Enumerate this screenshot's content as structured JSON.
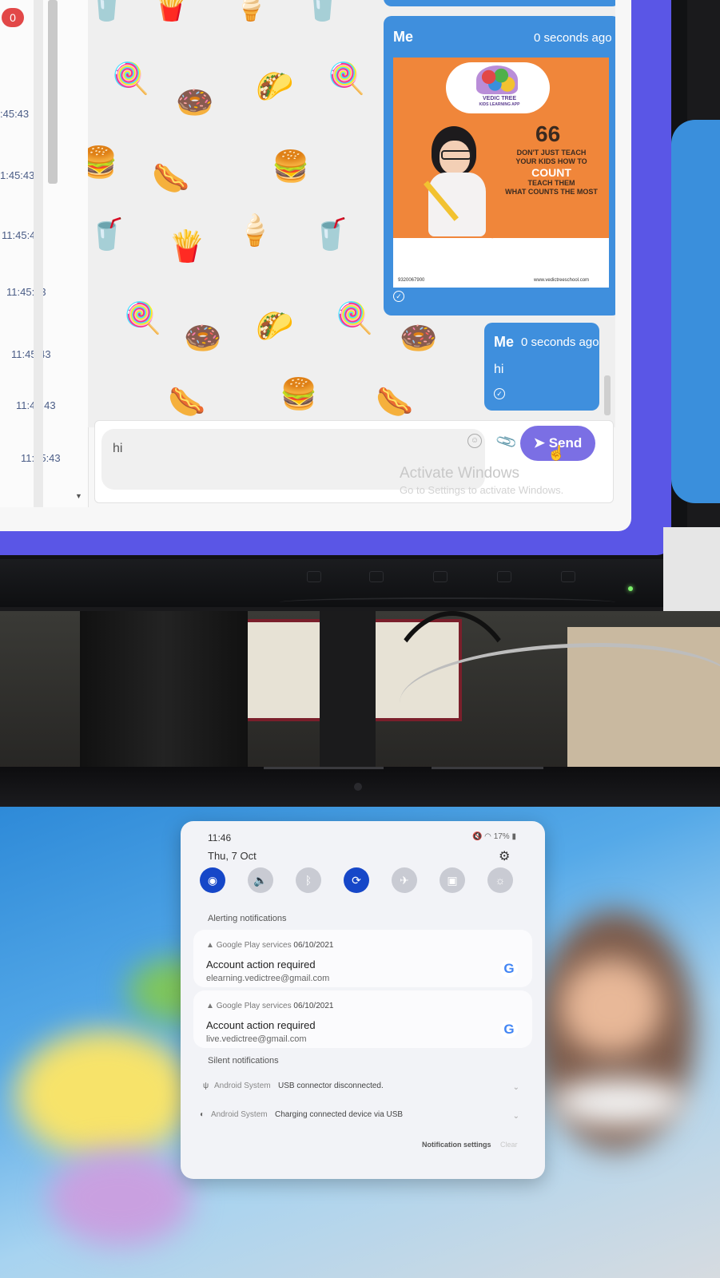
{
  "chat": {
    "unread_badge": "0",
    "timestamps": [
      ":45:43",
      "1:45:43",
      "11:45:43",
      "11:45:43",
      "11:45:43",
      "11:45:43",
      "11:45:43"
    ],
    "messages": [
      {
        "sender": "Me",
        "time": "0 seconds ago",
        "type": "image"
      },
      {
        "sender": "Me",
        "time": "0 seconds ago",
        "type": "text",
        "text": "hi"
      }
    ],
    "poster": {
      "logo": "VEDIC TREE",
      "logo_sub": "KIDS LEARNING APP",
      "quote_mark": "66",
      "quote_line1": "DON'T JUST TEACH",
      "quote_line2": "YOUR KIDS HOW TO",
      "quote_big": "COUNT",
      "quote_line3": "TEACH THEM",
      "quote_line4": "WHAT COUNTS THE MOST",
      "phone": "9320067900",
      "website": "www.vedictreeschool.com"
    },
    "composer": {
      "input_value": "hi",
      "send_label": "Send"
    },
    "watermark_title": "Activate Windows",
    "watermark_sub": "Go to Settings to activate Windows."
  },
  "tablet": {
    "time": "11:46",
    "status": "17%",
    "date": "Thu, 7 Oct",
    "quick_settings": [
      {
        "name": "wifi",
        "on": true
      },
      {
        "name": "sound",
        "on": false
      },
      {
        "name": "bluetooth",
        "on": false
      },
      {
        "name": "auto-rotate",
        "on": true
      },
      {
        "name": "airplane",
        "on": false
      },
      {
        "name": "flashlight",
        "on": false
      },
      {
        "name": "brightness",
        "on": false
      }
    ],
    "alerting_title": "Alerting notifications",
    "alerting": [
      {
        "app": "Google Play services",
        "date": "06/10/2021",
        "title": "Account action required",
        "subtitle": "elearning.vedictree@gmail.com"
      },
      {
        "app": "Google Play services",
        "date": "06/10/2021",
        "title": "Account action required",
        "subtitle": "live.vedictree@gmail.com"
      }
    ],
    "silent_title": "Silent notifications",
    "silent": [
      {
        "app": "Android System",
        "text": "USB connector disconnected."
      },
      {
        "app": "Android System",
        "text": "Charging connected device via USB"
      }
    ],
    "notification_settings": "Notification settings",
    "clear": "Clear"
  },
  "colors": {
    "accent_blue": "#3f8fdd",
    "send_purple": "#7b6fe4",
    "qs_on": "#1647c8",
    "badge_red": "#e24848"
  }
}
